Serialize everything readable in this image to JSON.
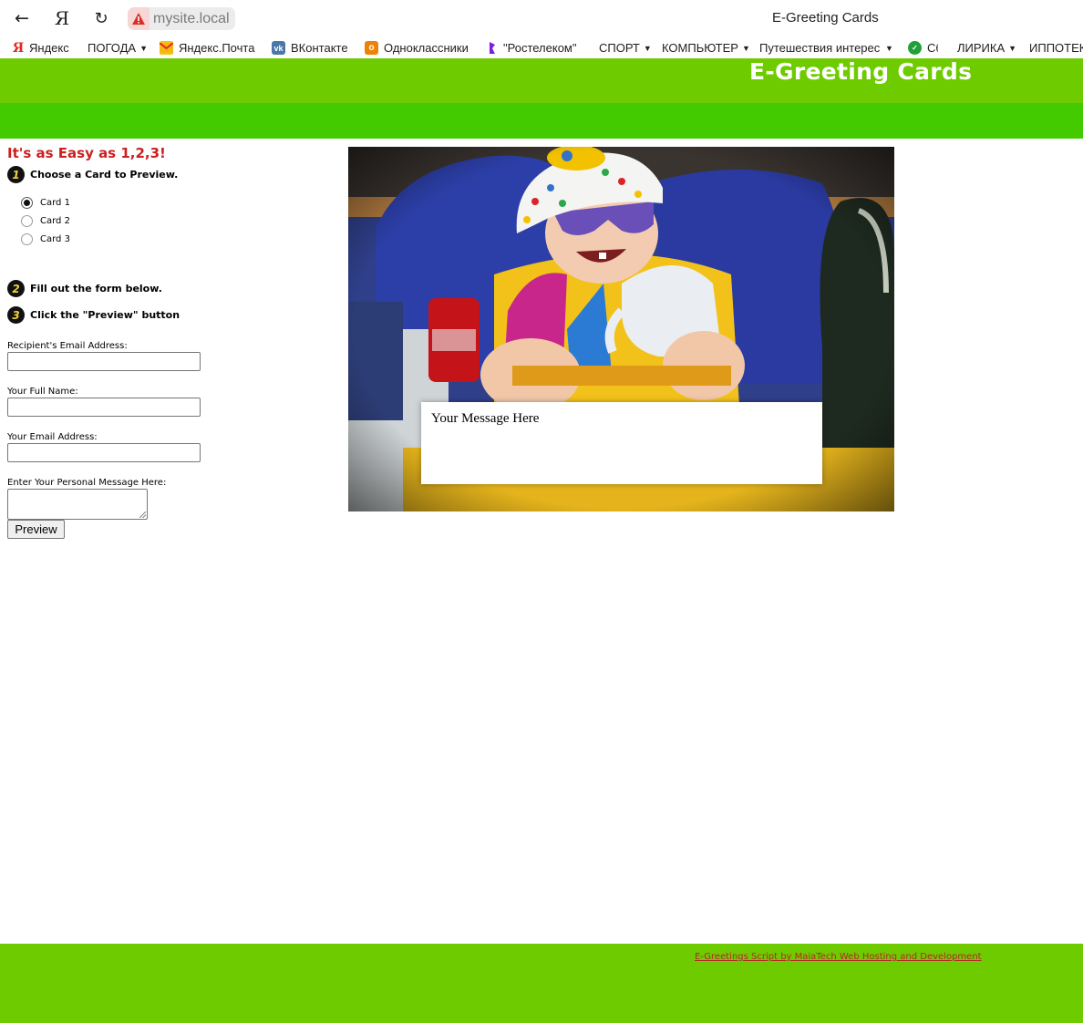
{
  "browser": {
    "url": "mysite.local",
    "tab_title": "E-Greeting Cards",
    "bookmarks": [
      {
        "label": "Яндекс",
        "icon": "yandex-icon",
        "menu": false
      },
      {
        "label": "ПОГОДА",
        "icon": "",
        "menu": true
      },
      {
        "label": "Яндекс.Почта",
        "icon": "mail-icon",
        "menu": false
      },
      {
        "label": "ВКонтакте",
        "icon": "vk-icon",
        "menu": false
      },
      {
        "label": "Одноклассники",
        "icon": "ok-icon",
        "menu": false
      },
      {
        "label": "\"Ростелеком\"",
        "icon": "rostelecom-icon",
        "menu": false
      },
      {
        "label": "СПОРТ",
        "icon": "",
        "menu": true
      },
      {
        "label": "КОМПЬЮТЕР",
        "icon": "",
        "menu": true
      },
      {
        "label": "Путешествия интерес",
        "icon": "",
        "menu": true
      },
      {
        "label": "Сб",
        "icon": "sber-icon",
        "menu": false
      },
      {
        "label": "ЛИРИКА",
        "icon": "",
        "menu": true
      },
      {
        "label": "ИППОТЕК",
        "icon": "",
        "menu": false
      }
    ]
  },
  "site": {
    "title": "E-Greeting Cards"
  },
  "sidebar": {
    "heading": "It's as Easy as 1,2,3!",
    "step1": {
      "num": "1",
      "text": "Choose a Card to Preview."
    },
    "cards": [
      {
        "label": "Card 1",
        "checked": true
      },
      {
        "label": "Card 2",
        "checked": false
      },
      {
        "label": "Card 3",
        "checked": false
      }
    ],
    "step2": {
      "num": "2",
      "text": "Fill out the form below."
    },
    "step3": {
      "num": "3",
      "text": "Click the \"Preview\" button"
    }
  },
  "form": {
    "recipient_label": "Recipient's Email Address:",
    "recipient_value": "",
    "name_label": "Your Full Name:",
    "name_value": "",
    "email_label": "Your Email Address:",
    "email_value": "",
    "message_label": "Enter Your Personal Message Here:",
    "message_value": "",
    "preview_button": "Preview"
  },
  "card": {
    "message": "Your Message Here",
    "image": "photo of a smiling toddler in a polka-dot hat and sunglasses wearing a yellow life vest"
  },
  "footer": {
    "link": "E-Greetings Script by MaiaTech Web Hosting and Development"
  },
  "colors": {
    "header": "#6ecb00",
    "subheader": "#44cb00",
    "heading_red": "#cc1f1f",
    "footer_link": "#b8242a"
  }
}
